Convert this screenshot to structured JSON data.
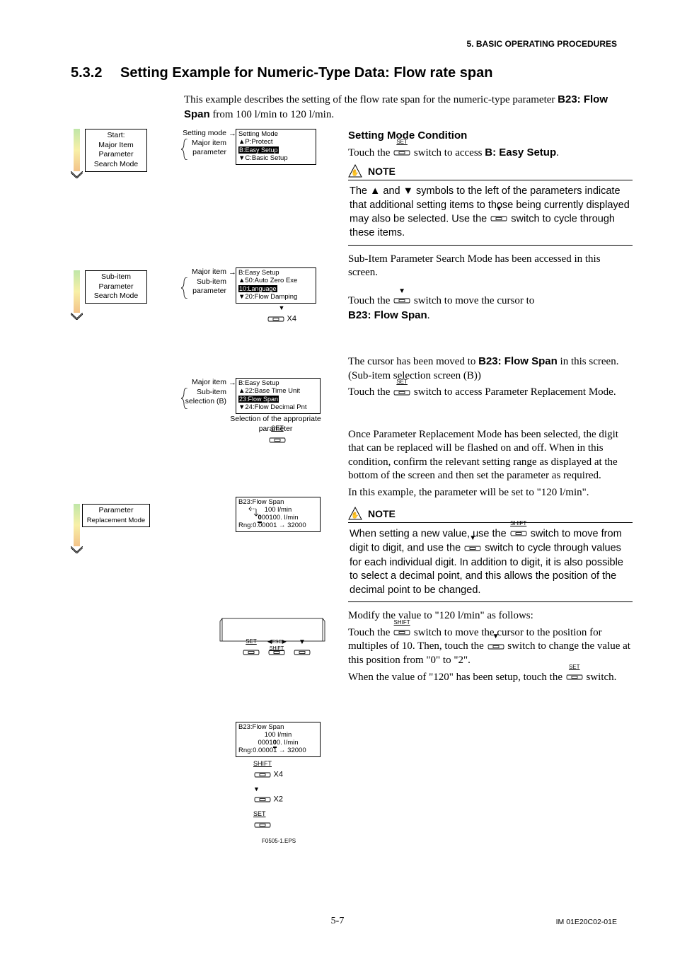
{
  "running_head": "5.  BASIC OPERATING PROCEDURES",
  "section_num": "5.3.2",
  "section_title": "Setting Example for Numeric-Type Data: Flow rate span",
  "intro_text_a": "This example describes the setting of the flow rate span for the numeric-type parameter ",
  "intro_bold": "B23: Flow Span",
  "intro_text_b": " from 100 l/min to 120 l/min.",
  "stage1_label": [
    "Start:",
    "Major Item",
    "Parameter",
    "Search Mode"
  ],
  "caption_setting_mode": "Setting mode",
  "caption_major_item": "Major item",
  "caption_parameter": "parameter",
  "lcd1_header": "Setting Mode",
  "lcd1_l1": "▲P:Protect",
  "lcd1_inv": "B:Easy Setup",
  "lcd1_l3": "▼C:Basic Setup",
  "right_heading": "Setting Mode Condition",
  "right_p1_a": "Touch the ",
  "right_p1_b": " switch to access ",
  "right_p1_bold": "B: Easy Setup",
  "right_p1_dot": ".",
  "note_label": "NOTE",
  "note1_a": "The ▲ and ▼ symbols to the left of the parameters indicate that additional setting items to those being currently displayed may also be selected. Use the ",
  "note1_b": " switch to cycle through these items.",
  "stage2_label": [
    "Sub-item",
    "Parameter",
    "Search Mode"
  ],
  "caption_sub_item": "Sub-item",
  "lcd2_header": "B:Easy Setup",
  "lcd2_l1": "▲50:Auto Zero Exe",
  "lcd2_inv": "10:Language",
  "lcd2_l3": "▼20:Flow Damping",
  "x4": "X4",
  "right_p2": "Sub-Item Parameter Search Mode has been accessed in this screen.",
  "right_p3_a": "Touch the ",
  "right_p3_b": " switch to move the cursor to ",
  "right_p3_bold": "B23: Flow Span",
  "lcd3_header": "B:Easy Setup",
  "lcd3_l1": "▲22:Base Time Unit",
  "lcd3_inv": "23:Flow Span",
  "lcd3_l3": "▼24:Flow Decimal Pnt",
  "caption_selection_b": "selection (B)",
  "sel_approp": "Selection of the appropriate parameter",
  "right_p4_a": "The cursor has been moved to ",
  "right_p4_b": " in this screen. (Sub-item selection screen (B))",
  "right_p5_a": "Touch the ",
  "right_p5_b": " switch to access Parameter Replacement Mode.",
  "stage3_label": [
    "Parameter",
    "Replacement Mode"
  ],
  "lcd4_header": "B23:Flow Span",
  "lcd4_l1": "100  l/min",
  "lcd4_l2a": "0",
  "lcd4_l2b": "00100. l/min",
  "lcd4_l3": "Rng:0.00001 → 32000",
  "right_p6": "Once Parameter Replacement Mode has been selected, the digit that can be replaced will be flashed on and off. When in this condition, confirm the relevant setting range as displayed at the bottom of the screen and then set the parameter as required.",
  "right_p7": "In this example, the parameter will be set to \"120 l/min\".",
  "note2_a": "When setting a new value, use the ",
  "note2_b": " switch to move from digit to digit, and use the ",
  "note2_c": " switch to cycle through values for each individual digit. In addition to digit, it is also possible to select a decimal point, and this allows the position of the decimal point to be changed.",
  "lcd5_header": "B23:Flow Span",
  "lcd5_l1": "100  l/min",
  "lcd5_l2a": "0001",
  "lcd5_l2b": "0",
  "lcd5_l2c": "0. l/min",
  "lcd5_l3": "Rng:0.00001 → 32000",
  "right_p8": "Modify the value to \"120 l/min\" as follows:",
  "right_p9_a": "Touch the ",
  "right_p9_b": " switch to move the cursor to the position for multiples of 10. Then, touch the ",
  "right_p9_c": " switch to change the value at this position from \"0\" to \"2\".",
  "right_p10_a": "When the value of \"120\" has been setup, touch the ",
  "right_p10_b": " switch.",
  "x2": "X2",
  "eps": "F0505-1.EPS",
  "pg": "5-7",
  "docid": "IM 01E20C02-01E",
  "lbl_set": "SET",
  "lbl_shift": "SHIFT",
  "lbl_esc": "ESC"
}
